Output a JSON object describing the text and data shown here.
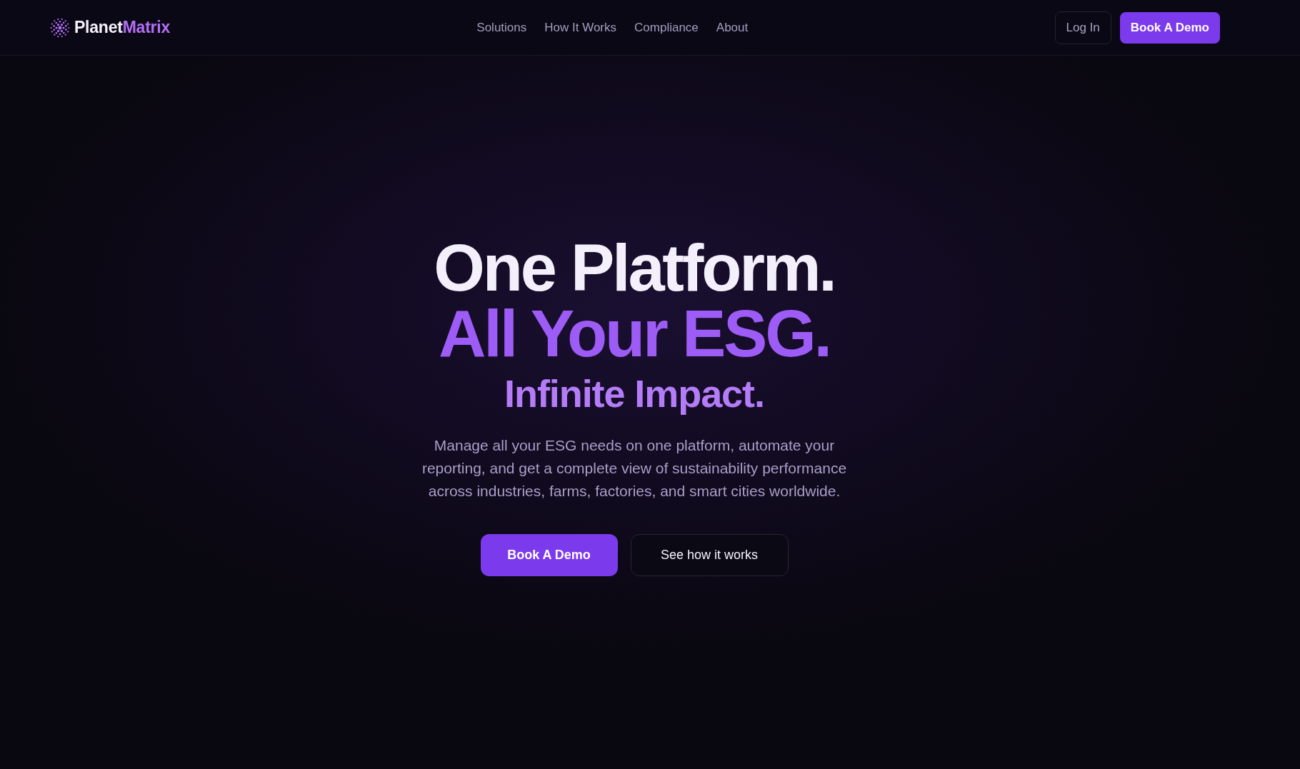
{
  "header": {
    "logo": {
      "name": "Planet",
      "accent": "Matrix"
    },
    "nav_links": [
      "Solutions",
      "How It Works",
      "Compliance",
      "About"
    ],
    "actions": [
      {
        "label": "Log In",
        "kind": "outline"
      },
      {
        "label": "Book A Demo",
        "kind": "primary"
      }
    ]
  },
  "hero": {
    "headline_lines": [
      {
        "text": "One Platform.",
        "kind": "primary"
      },
      {
        "text": "All Your ESG.",
        "kind": "accent"
      }
    ],
    "subheadline": "Infinite Impact.",
    "description": "Manage all your ESG needs on one platform, automate your reporting, and get a complete view of sustainability performance across industries, farms, factories, and smart cities worldwide.",
    "buttons": [
      {
        "label": "Book A Demo",
        "kind": "primary"
      },
      {
        "label": "See how it works",
        "kind": "outline"
      }
    ]
  }
}
